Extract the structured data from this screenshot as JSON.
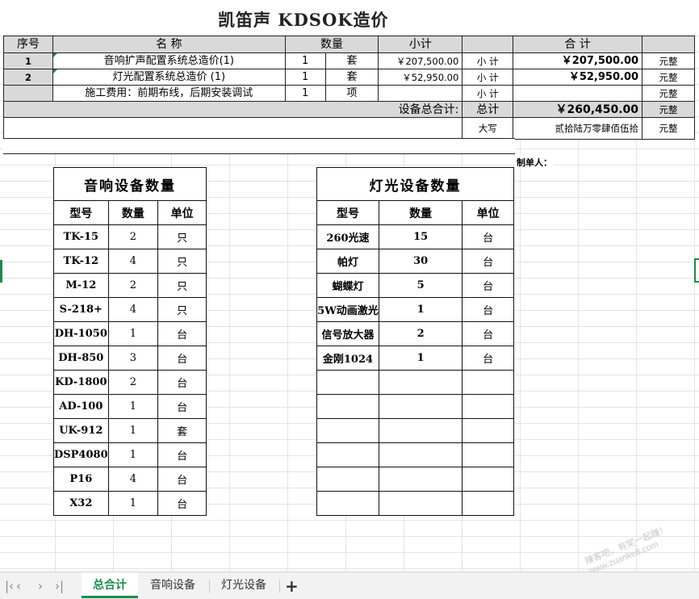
{
  "title": "凯笛声 KDSOK造价",
  "summary": {
    "headers": [
      "序号",
      "名        称",
      "数量",
      "小计",
      "",
      "合   计",
      ""
    ],
    "rows": [
      {
        "no": "1",
        "name": "音响扩声配置系统总造价(1)",
        "qty": "1",
        "unit": "套",
        "subtotal": "￥207,500.00",
        "label": "小 计",
        "total": "￥207,500.00",
        "suffix": "元整"
      },
      {
        "no": "2",
        "name": "灯光配置系统总造价 (1)",
        "qty": "1",
        "unit": "套",
        "subtotal": "￥52,950.00",
        "label": "小 计",
        "total": "￥52,950.00",
        "suffix": "元整"
      },
      {
        "no": "",
        "name": "施工费用：前期布线，后期安装调试",
        "qty": "1",
        "unit": "项",
        "subtotal": "",
        "label": "小 计",
        "total": "",
        "suffix": "元整"
      }
    ],
    "grand": {
      "label": "设备总合计:",
      "tag": "总计",
      "value": "￥260,450.00",
      "suffix": "元整"
    },
    "capital": {
      "label": "大写",
      "value": "贰拾陆万零肆佰伍拾",
      "suffix": "元整"
    },
    "maker": "制单人："
  },
  "audio": {
    "title": "音响设备数量",
    "headers": [
      "型号",
      "数量",
      "单位"
    ],
    "rows": [
      [
        "TK-15",
        "2",
        "只"
      ],
      [
        "TK-12",
        "4",
        "只"
      ],
      [
        "M-12",
        "2",
        "只"
      ],
      [
        "S-218+",
        "4",
        "只"
      ],
      [
        "DH-1050",
        "1",
        "台"
      ],
      [
        "DH-850",
        "3",
        "台"
      ],
      [
        "KD-1800",
        "2",
        "台"
      ],
      [
        "AD-100",
        "1",
        "台"
      ],
      [
        "UK-912",
        "1",
        "套"
      ],
      [
        "DSP4080",
        "1",
        "台"
      ],
      [
        "P16",
        "4",
        "台"
      ],
      [
        "X32",
        "1",
        "台"
      ]
    ]
  },
  "lighting": {
    "title": "灯光设备数量",
    "headers": [
      "型号",
      "数量",
      "单位"
    ],
    "rows": [
      [
        "260光速",
        "15",
        "台"
      ],
      [
        "帕灯",
        "30",
        "台"
      ],
      [
        "蝴蝶灯",
        "5",
        "台"
      ],
      [
        "5W动画激光",
        "1",
        "台"
      ],
      [
        "信号放大器",
        "2",
        "台"
      ],
      [
        "金刚1024",
        "1",
        "台"
      ],
      [
        "",
        "",
        ""
      ],
      [
        "",
        "",
        ""
      ],
      [
        "",
        "",
        ""
      ],
      [
        "",
        "",
        ""
      ],
      [
        "",
        "",
        ""
      ],
      [
        "",
        "",
        ""
      ]
    ]
  },
  "tabs": {
    "items": [
      "总合计",
      "音响设备",
      "灯光设备"
    ],
    "active": 0,
    "add": "+"
  },
  "watermark": "赚客吧，有奖一起赚！ www.zuanke8.com",
  "colors": {
    "accent": "#1f8a4c",
    "header_gray": "#d9d9d9"
  }
}
